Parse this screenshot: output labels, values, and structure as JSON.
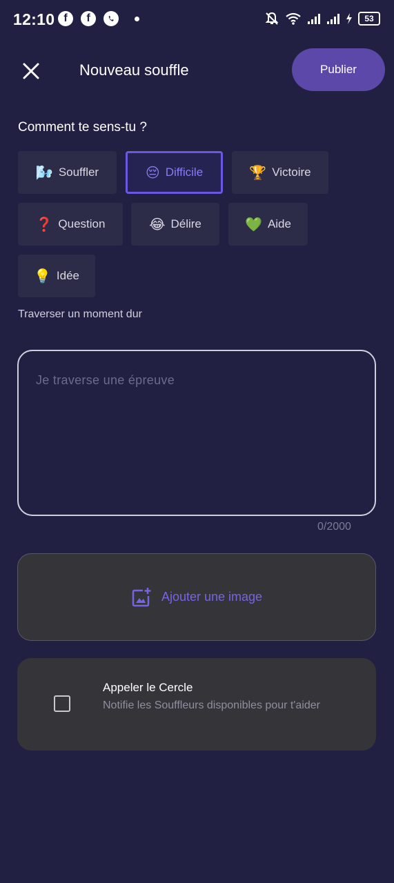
{
  "status_bar": {
    "time": "12:10",
    "battery": "53",
    "left_icons": [
      "facebook-messenger-icon",
      "facebook-icon",
      "whatsapp-icon",
      "dot"
    ],
    "right_icons": [
      "notifications-off-icon",
      "wifi-icon",
      "signal-icon",
      "signal-icon",
      "charging-icon",
      "battery-icon"
    ]
  },
  "header": {
    "title": "Nouveau souffle",
    "publish_label": "Publier"
  },
  "mood": {
    "question": "Comment te sens-tu ?",
    "options": [
      {
        "emoji": "🌬️",
        "label": "Souffler"
      },
      {
        "emoji": "😔",
        "label": "Difficile"
      },
      {
        "emoji": "🏆",
        "label": "Victoire"
      },
      {
        "emoji": "❓",
        "label": "Question"
      },
      {
        "emoji": "😂",
        "label": "Délire"
      },
      {
        "emoji": "💚",
        "label": "Aide"
      },
      {
        "emoji": "💡",
        "label": "Idée"
      }
    ],
    "selected": "Difficile",
    "description": "Traverser un moment dur"
  },
  "composer": {
    "placeholder": "Je traverse une épreuve",
    "value": "",
    "counter": "0/2000"
  },
  "image": {
    "label": "Ajouter une image"
  },
  "circle": {
    "title": "Appeler le Cercle",
    "description": "Notifie les Souffleurs disponibles pour t'aider",
    "checked": false
  },
  "colors": {
    "background": "#212042",
    "accent": "#5b48a8",
    "selected": "#6a59e0",
    "card": "#353439"
  }
}
